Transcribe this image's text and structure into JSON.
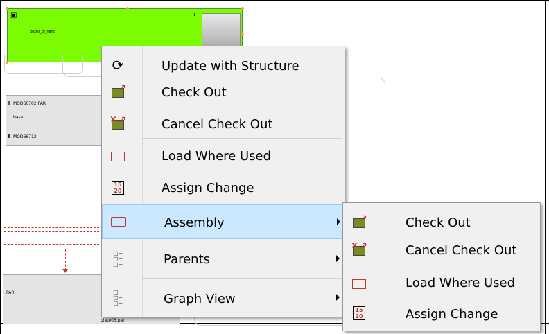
{
  "canvas": {
    "green_node": {
      "title": "boxes_of_hand",
      "number": "1"
    },
    "gray_node": {
      "line1": "MOD66702.PAR",
      "line2": "base",
      "line3": "MOD66712"
    },
    "gray_node2": {
      "title": "PAR",
      "footer": "plate03.par"
    }
  },
  "context_menu": {
    "items": [
      {
        "label": "Update with Structure",
        "icon": "update-structure-icon"
      },
      {
        "label": "Check Out",
        "icon": "check-out-icon"
      },
      {
        "label": "Cancel Check Out",
        "icon": "cancel-check-out-icon"
      },
      {
        "label": "Load Where Used",
        "icon": "load-where-used-icon"
      },
      {
        "label": "Assign Change",
        "icon": "assign-change-icon"
      },
      {
        "label": "Assembly",
        "icon": "assembly-icon",
        "highlighted": true,
        "submenu": true
      },
      {
        "label": "Parents",
        "icon": "parents-icon",
        "submenu": true
      },
      {
        "label": "Graph View",
        "icon": "graph-view-icon",
        "submenu": true
      }
    ]
  },
  "submenu": {
    "items": [
      {
        "label": "Check Out",
        "icon": "check-out-icon"
      },
      {
        "label": "Cancel Check Out",
        "icon": "cancel-check-out-icon"
      },
      {
        "label": "Load Where Used",
        "icon": "load-where-used-icon"
      },
      {
        "label": "Assign Change",
        "icon": "assign-change-icon"
      }
    ]
  },
  "colors": {
    "node_green": "#7cfc00",
    "highlight": "#cce8ff",
    "menu_bg": "#f0f0f0",
    "accent_red": "#c0392b"
  }
}
